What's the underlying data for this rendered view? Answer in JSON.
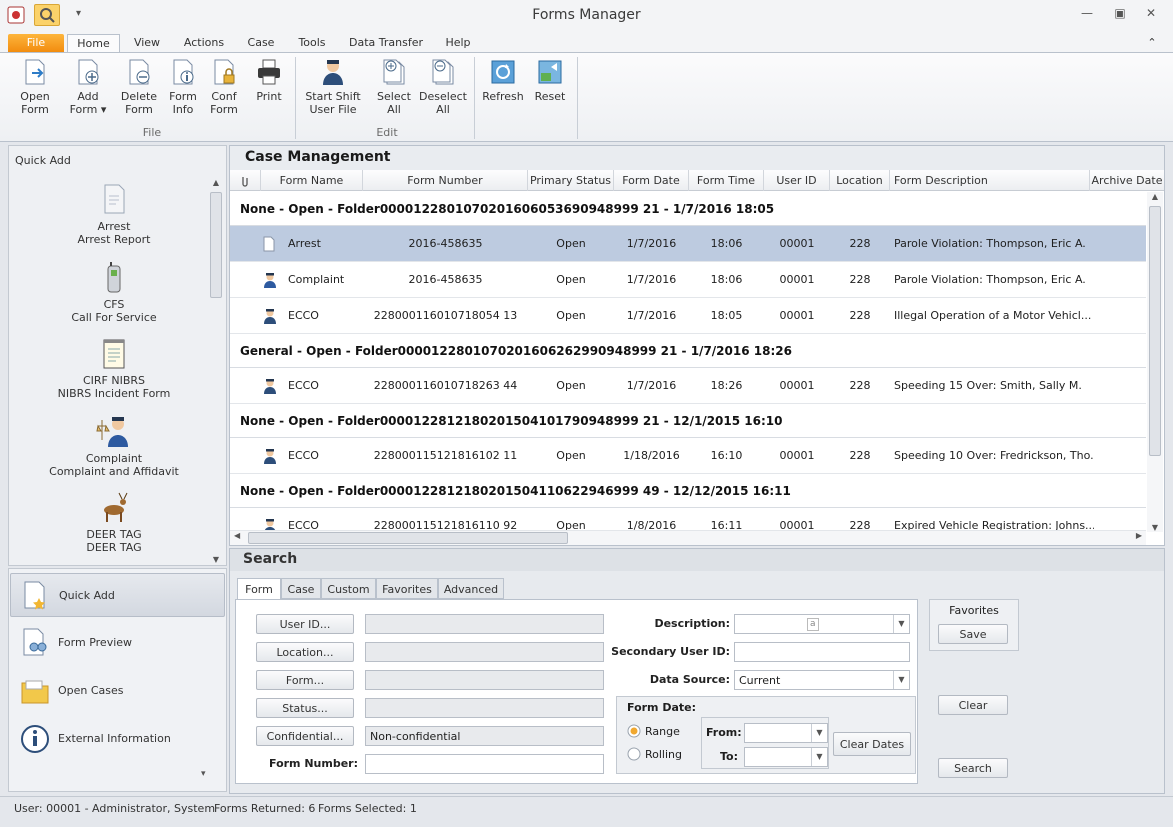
{
  "window": {
    "title": "Forms Manager",
    "controls": {
      "minimize": "—",
      "restore": "▣",
      "close": "✕"
    },
    "collapse_ribbon": "⌃",
    "qat_dropdown": "▾"
  },
  "ribbon_tabs": [
    "File",
    "Home",
    "View",
    "Actions",
    "Case",
    "Tools",
    "Data Transfer",
    "Help"
  ],
  "ribbon": {
    "file_buttons": [
      {
        "line1": "Open",
        "line2": "Form"
      },
      {
        "line1": "Add",
        "line2": "Form ▾"
      },
      {
        "line1": "Delete",
        "line2": "Form"
      },
      {
        "line1": "Form",
        "line2": "Info"
      },
      {
        "line1": "Conf",
        "line2": "Form"
      },
      {
        "line1": "Print",
        "line2": ""
      }
    ],
    "file_group_label": "File",
    "edit_buttons": [
      {
        "line1": "Start Shift",
        "line2": "User File"
      },
      {
        "line1": "Select",
        "line2": "All"
      },
      {
        "line1": "Deselect",
        "line2": "All"
      }
    ],
    "edit_group_label": "Edit",
    "other_buttons": [
      {
        "line1": "Refresh",
        "line2": ""
      },
      {
        "line1": "Reset",
        "line2": ""
      }
    ]
  },
  "quick_add": {
    "header": "Quick Add",
    "items": [
      {
        "line1": "Arrest",
        "line2": "Arrest Report",
        "icon": "document-icon"
      },
      {
        "line1": "CFS",
        "line2": "Call For Service",
        "icon": "radio-icon"
      },
      {
        "line1": "CIRF NIBRS",
        "line2": "NIBRS Incident Form",
        "icon": "notepad-icon"
      },
      {
        "line1": "Complaint",
        "line2": "Complaint and Affidavit",
        "icon": "officer-scales-icon"
      },
      {
        "line1": "DEER TAG",
        "line2": "DEER TAG",
        "icon": "deer-icon"
      }
    ]
  },
  "nav": {
    "items": [
      {
        "label": "Quick Add",
        "icon": "quick-add-icon",
        "active": true
      },
      {
        "label": "Form Preview",
        "icon": "form-preview-icon",
        "active": false
      },
      {
        "label": "Open Cases",
        "icon": "folder-icon",
        "active": false
      },
      {
        "label": "External Information",
        "icon": "info-icon",
        "active": false
      }
    ],
    "more": "▾"
  },
  "case_management": {
    "title": "Case Management",
    "columns": [
      "Form Name",
      "Form Number",
      "Primary Status",
      "Form Date",
      "Form Time",
      "User ID",
      "Location",
      "Form Description",
      "Archive Date"
    ],
    "attachment_icon": "paperclip-icon",
    "groups": [
      {
        "header": "None  -  Open  -  Folder0000122801070201606053690948999 21  -  1/7/2016 18:05",
        "rows": [
          {
            "icon": "document-icon",
            "form_name": "Arrest",
            "form_number": "2016-458635",
            "status": "Open",
            "date": "1/7/2016",
            "time": "18:06",
            "user_id": "00001",
            "location": "228",
            "description": "Parole Violation: Thompson, Eric A.",
            "selected": true
          },
          {
            "icon": "officer-icon",
            "form_name": "Complaint",
            "form_number": "2016-458635",
            "status": "Open",
            "date": "1/7/2016",
            "time": "18:06",
            "user_id": "00001",
            "location": "228",
            "description": "Parole Violation: Thompson, Eric A.",
            "selected": false
          },
          {
            "icon": "officer-car-icon",
            "form_name": "ECCO",
            "form_number": "228000116010718054 13",
            "status": "Open",
            "date": "1/7/2016",
            "time": "18:05",
            "user_id": "00001",
            "location": "228",
            "description": "Illegal Operation of a Motor Vehicl...",
            "selected": false
          }
        ]
      },
      {
        "header": "General  -  Open  -  Folder0000122801070201606262990948999 21  -  1/7/2016 18:26",
        "rows": [
          {
            "icon": "officer-car-icon",
            "form_name": "ECCO",
            "form_number": "228000116010718263 44",
            "status": "Open",
            "date": "1/7/2016",
            "time": "18:26",
            "user_id": "00001",
            "location": "228",
            "description": "Speeding 15 Over: Smith, Sally M.",
            "selected": false
          }
        ]
      },
      {
        "header": "None  -  Open  -  Folder0000122812180201504101790948999 21  -  12/1/2015 16:10",
        "rows": [
          {
            "icon": "officer-car-icon",
            "form_name": "ECCO",
            "form_number": "228000115121816102 11",
            "status": "Open",
            "date": "1/18/2016",
            "time": "16:10",
            "user_id": "00001",
            "location": "228",
            "description": "Speeding 10 Over: Fredrickson, Tho...",
            "selected": false
          }
        ]
      },
      {
        "header": "None  -  Open  -  Folder0000122812180201504110622946999 49  -  12/12/2015 16:11",
        "rows": [
          {
            "icon": "officer-car-icon",
            "form_name": "ECCO",
            "form_number": "228000115121816110 92",
            "status": "Open",
            "date": "1/8/2016",
            "time": "16:11",
            "user_id": "00001",
            "location": "228",
            "description": "Expired Vehicle Registration: Johns...",
            "selected": false
          }
        ]
      }
    ]
  },
  "search": {
    "title": "Search",
    "tabs": [
      "Form",
      "Case",
      "Custom",
      "Favorites",
      "Advanced"
    ],
    "buttons": {
      "user_id": "User ID...",
      "location": "Location...",
      "form": "Form...",
      "status": "Status...",
      "confidential": "Confidential..."
    },
    "values": {
      "user_id": "",
      "location": "",
      "form": "",
      "status": "",
      "confidential": "Non-confidential"
    },
    "form_number_label": "Form Number:",
    "form_number_value": "",
    "description_label": "Description:",
    "secondary_user_label": "Secondary User ID:",
    "data_source_label": "Data Source:",
    "data_source_value": "Current",
    "form_date": {
      "title": "Form Date:",
      "range": "Range",
      "rolling": "Rolling",
      "from": "From:",
      "to": "To:",
      "clear_dates": "Clear Dates"
    },
    "favorites": {
      "title": "Favorites",
      "save": "Save"
    },
    "clear": "Clear",
    "search": "Search"
  },
  "status_bar": {
    "user": "User: 00001 - Administrator, System",
    "returned": "Forms Returned: 6",
    "selected": "Forms Selected: 1"
  }
}
